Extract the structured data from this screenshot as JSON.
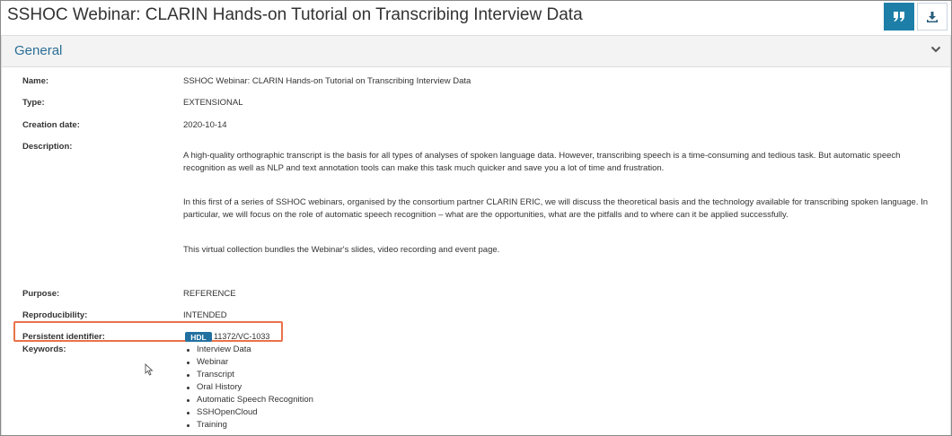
{
  "page": {
    "title": "SSHOC Webinar: CLARIN Hands-on Tutorial on Transcribing Interview Data",
    "actions": {
      "cite_icon": "quote-icon",
      "download_icon": "download-icon"
    }
  },
  "panel": {
    "title": "General",
    "toggle_icon": "chevron-down-icon"
  },
  "fields": {
    "name": {
      "label": "Name:",
      "value": "SSHOC Webinar: CLARIN Hands-on Tutorial on Transcribing Interview Data"
    },
    "type": {
      "label": "Type:",
      "value": "EXTENSIONAL"
    },
    "creation_date": {
      "label": "Creation date:",
      "value": "2020-10-14"
    },
    "description": {
      "label": "Description:",
      "paragraphs": [
        "A high-quality orthographic transcript is the basis for all types of analyses of spoken language data. However, transcribing speech is a time-consuming and tedious task. But automatic speech recognition as well as NLP and text annotation tools can make this task much quicker and save you a lot of time and frustration.",
        "In this first of a series of SSHOC webinars, organised by the consortium partner CLARIN ERIC, we will discuss the theoretical basis and the technology available for transcribing spoken language. In particular, we will focus on the role of automatic speech recognition – what are the opportunities, what are the pitfalls and to where can it be applied successfully.",
        "This virtual collection bundles the Webinar's slides, video recording and event page."
      ]
    },
    "purpose": {
      "label": "Purpose:",
      "value": "REFERENCE"
    },
    "reproducibility": {
      "label": "Reproducibility:",
      "value": "INTENDED"
    },
    "persistent_identifier": {
      "label": "Persistent identifier:",
      "badge": "HDL",
      "value": "11372/VC-1033"
    },
    "keywords": {
      "label": "Keywords:",
      "items": [
        "Interview Data",
        "Webinar",
        "Transcript",
        "Oral History",
        "Automatic Speech Recognition",
        "SSHOpenCloud",
        "Training"
      ]
    }
  },
  "colors": {
    "accent": "#1d7fa8",
    "highlight": "#e8734a",
    "badge": "#2270a0"
  }
}
